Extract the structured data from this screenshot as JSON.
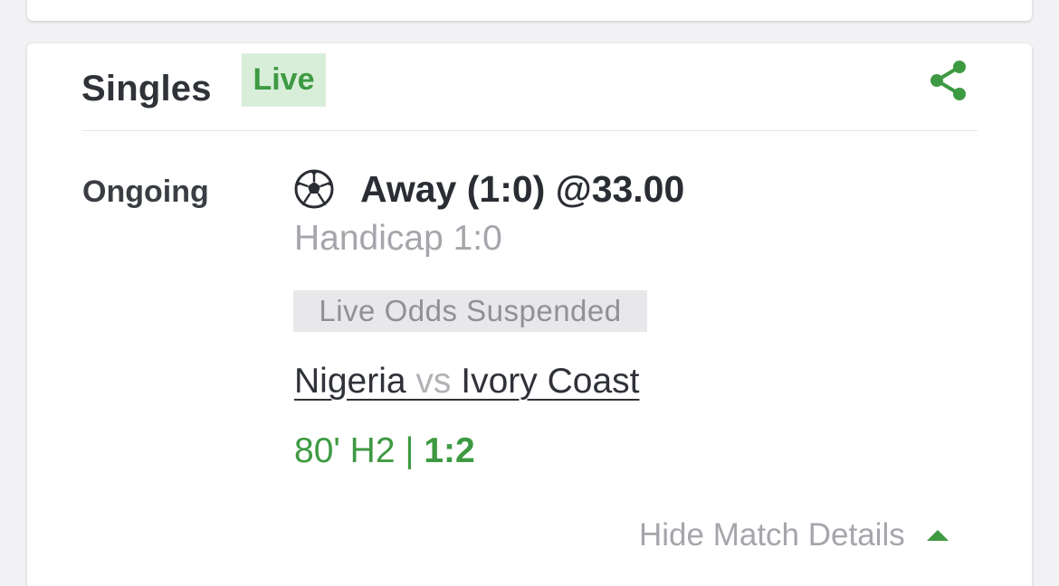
{
  "section": {
    "title": "Singles",
    "live_badge": "Live"
  },
  "bet": {
    "status": "Ongoing",
    "selection": "Away (1:0) @33.00",
    "market": "Handicap 1:0",
    "notice": "Live Odds Suspended",
    "home_team": "Nigeria",
    "vs": "vs",
    "away_team": "Ivory Coast",
    "match_time": "80' H2 |",
    "score": "1:2"
  },
  "footer": {
    "toggle_label": "Hide Match Details"
  },
  "icons": {
    "share": "share-icon",
    "sport": "soccer-ball-icon",
    "toggle": "caret-up-icon"
  },
  "colors": {
    "accent_green": "#3e9a42",
    "badge_bg": "#d8eed9",
    "muted_text": "#a4a6ab"
  }
}
